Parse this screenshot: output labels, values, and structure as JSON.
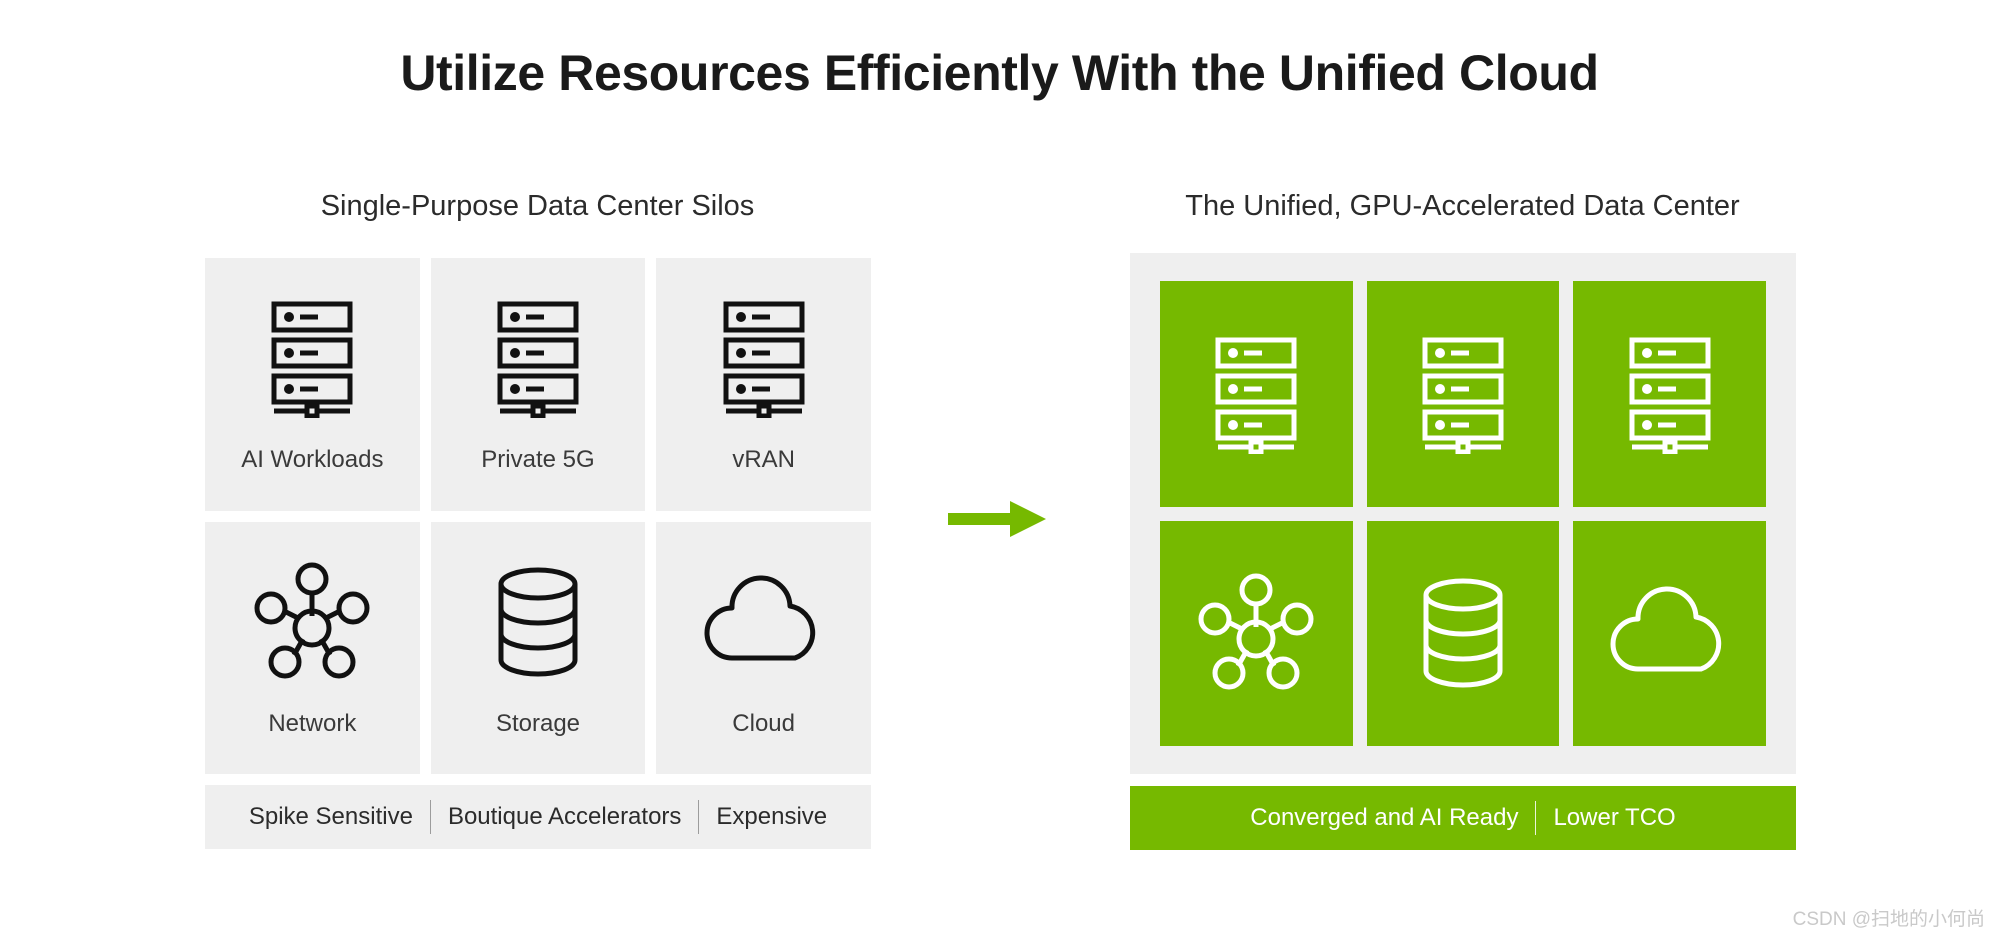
{
  "page": {
    "title": "Utilize Resources Efficiently With the Unified Cloud",
    "background_color": "#ffffff",
    "watermark": "CSDN @扫地的小何尚"
  },
  "colors": {
    "accent_green": "#76b900",
    "tile_gray": "#efefef",
    "text_dark": "#1a1a1a",
    "icon_dark": "#111111",
    "icon_light": "#ffffff"
  },
  "left_panel": {
    "heading": "Single-Purpose Data Center Silos",
    "tiles": [
      {
        "label": "AI Workloads",
        "icon": "server-rack-icon"
      },
      {
        "label": "Private 5G",
        "icon": "server-rack-icon"
      },
      {
        "label": "vRAN",
        "icon": "server-rack-icon"
      },
      {
        "label": "Network",
        "icon": "network-hub-icon"
      },
      {
        "label": "Storage",
        "icon": "database-cylinder-icon"
      },
      {
        "label": "Cloud",
        "icon": "cloud-icon"
      }
    ],
    "footer_chips": [
      "Spike Sensitive",
      "Boutique Accelerators",
      "Expensive"
    ]
  },
  "transition": {
    "icon": "arrow-right-icon",
    "color": "#76b900"
  },
  "right_panel": {
    "heading": "The Unified, GPU-Accelerated Data Center",
    "tiles": [
      {
        "label": "",
        "icon": "server-rack-icon"
      },
      {
        "label": "",
        "icon": "server-rack-icon"
      },
      {
        "label": "",
        "icon": "server-rack-icon"
      },
      {
        "label": "",
        "icon": "network-hub-icon"
      },
      {
        "label": "",
        "icon": "database-cylinder-icon"
      },
      {
        "label": "",
        "icon": "cloud-icon"
      }
    ],
    "footer_chips": [
      "Converged and AI Ready",
      "Lower TCO"
    ]
  }
}
